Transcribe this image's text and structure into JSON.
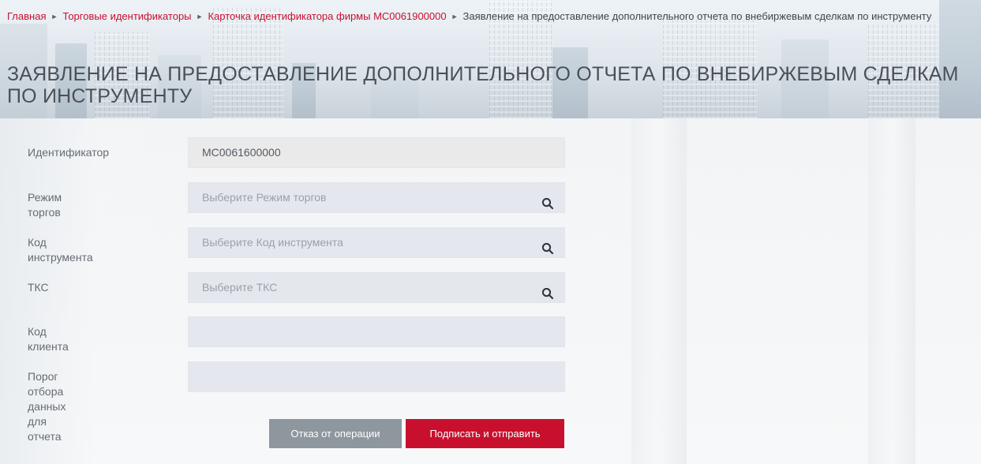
{
  "breadcrumb": {
    "items": [
      "Главная",
      "Торговые идентификаторы",
      "Карточка идентификатора фирмы MC0061900000"
    ],
    "current": "Заявление на предоставление дополнительного отчета по внебиржевым сделкам по инструменту"
  },
  "page_title": "ЗАЯВЛЕНИЕ НА ПРЕДОСТАВЛЕНИЕ ДОПОЛНИТЕЛЬНОГО ОТЧЕТА ПО ВНЕБИРЖЕВЫМ СДЕЛКАМ ПО ИНСТРУМЕНТУ",
  "form": {
    "identifier": {
      "label": "Идентификатор",
      "value": "MC0061600000"
    },
    "trade_mode": {
      "label": "Режим торгов",
      "placeholder": "Выберите Режим торгов",
      "icon": "search-icon"
    },
    "instrument_code": {
      "label": "Код инструмента",
      "placeholder": "Выберите Код инструмента",
      "icon": "search-icon"
    },
    "tks": {
      "label": "ТКС",
      "placeholder": "Выберите ТКС",
      "icon": "search-icon"
    },
    "client_code": {
      "label": "Код клиента",
      "value": ""
    },
    "threshold": {
      "label_line1": "Порог отбора",
      "label_line2": "данных для отчета",
      "value": ""
    }
  },
  "buttons": {
    "cancel": "Отказ от операции",
    "submit": "Подписать и отправить"
  },
  "colors": {
    "accent": "#c8102e",
    "cancel_button": "#8e979e",
    "field_bg": "#e4e8ee"
  }
}
